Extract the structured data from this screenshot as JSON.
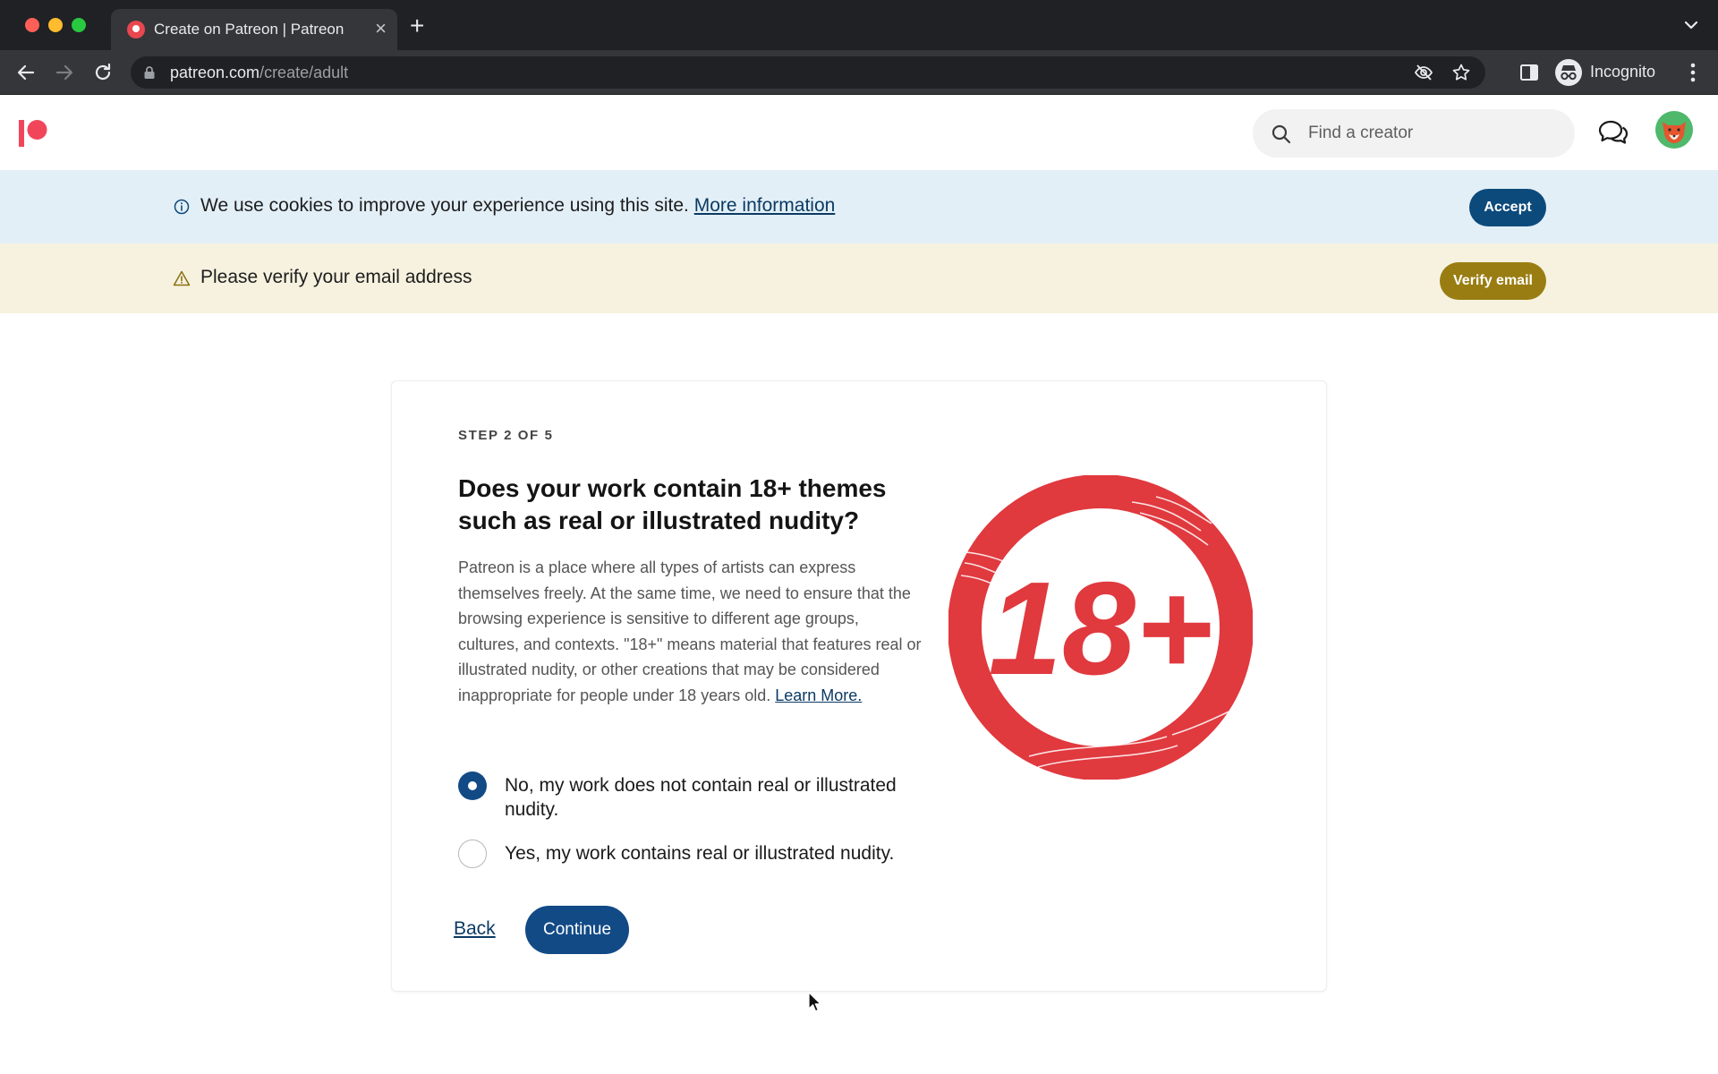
{
  "browser": {
    "tab_title": "Create on Patreon | Patreon",
    "tab_close": "×",
    "new_tab": "+",
    "url_host": "patreon.com",
    "url_path": "/create/adult",
    "profile_label": "Incognito"
  },
  "header": {
    "search_placeholder": "Find a creator",
    "icons": [
      "patreon-logo",
      "search-icon",
      "chat-icon",
      "user-avatar"
    ]
  },
  "cookie_banner": {
    "text": "We use cookies to improve your experience using this site.",
    "link": "More information",
    "button": "Accept"
  },
  "verify_banner": {
    "text": "Please verify your email address",
    "button": "Verify email"
  },
  "card": {
    "step": "STEP 2 OF 5",
    "headline": "Does your work contain 18+ themes such as real or illustrated nudity?",
    "description": "Patreon is a place where all types of artists can express themselves freely. At the same time, we need to ensure that the browsing experience is sensitive to different age groups, cultures, and contexts. \"18+\" means material that features real or illustrated nudity, or other creations that may be considered inappropriate for people under 18 years old.",
    "learn_more": "Learn More.",
    "badge_text": "18+",
    "options": [
      {
        "label": "No, my work does not contain real or illustrated nudity.",
        "selected": true
      },
      {
        "label": "Yes, my work contains real or illustrated nudity.",
        "selected": false
      }
    ],
    "back": "Back",
    "continue": "Continue"
  },
  "colors": {
    "brand_red": "#e0393e",
    "primary_navy": "#124a86",
    "cookie_bg": "#e3eff7",
    "verify_bg": "#f6f2df",
    "verify_button": "#9a7d12"
  }
}
